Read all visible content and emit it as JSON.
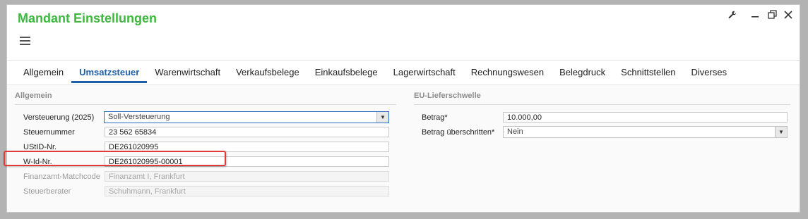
{
  "window": {
    "title": "Mandant Einstellungen"
  },
  "controls": {
    "wrench": "🔧",
    "minimize": "⎯",
    "restore": "⧉",
    "close": "✕"
  },
  "tabs": [
    {
      "label": "Allgemein",
      "active": false
    },
    {
      "label": "Umsatzsteuer",
      "active": true
    },
    {
      "label": "Warenwirtschaft",
      "active": false
    },
    {
      "label": "Verkaufsbelege",
      "active": false
    },
    {
      "label": "Einkaufsbelege",
      "active": false
    },
    {
      "label": "Lagerwirtschaft",
      "active": false
    },
    {
      "label": "Rechnungswesen",
      "active": false
    },
    {
      "label": "Belegdruck",
      "active": false
    },
    {
      "label": "Schnittstellen",
      "active": false
    },
    {
      "label": "Diverses",
      "active": false
    }
  ],
  "allgemein": {
    "section_title": "Allgemein",
    "versteuerung_label": "Versteuerung (2025)",
    "versteuerung_value": "Soll-Versteuerung",
    "steuernummer_label": "Steuernummer",
    "steuernummer_value": "23 562 65834",
    "ustid_label": "UStID-Nr.",
    "ustid_value": "DE261020995",
    "wid_label": "W-Id-Nr.",
    "wid_value": "DE261020995-00001",
    "finanzamt_label": "Finanzamt-Matchcode",
    "finanzamt_value": "Finanzamt I, Frankfurt",
    "steuerberater_label": "Steuerberater",
    "steuerberater_value": "Schuhmann, Frankfurt"
  },
  "eu": {
    "section_title": "EU-Lieferschwelle",
    "betrag_label": "Betrag*",
    "betrag_value": "10.000,00",
    "ueberschritten_label": "Betrag überschritten*",
    "ueberschritten_value": "Nein"
  },
  "colors": {
    "title": "#3cb93c",
    "accent": "#1f5fa8",
    "highlight": "#e33939"
  }
}
